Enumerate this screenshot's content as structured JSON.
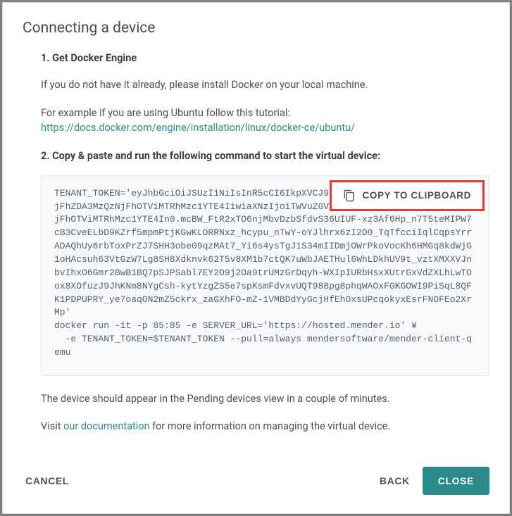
{
  "modal": {
    "title": "Connecting a device",
    "steps": {
      "step1_title": "1. Get Docker Engine",
      "step1_intro": "If you do not have it already, please install Docker on your local machine.",
      "step1_example_lead": "For example if you are using Ubuntu follow this tutorial:",
      "step1_link": "https://docs.docker.com/engine/installation/linux/docker-ce/ubuntu/",
      "step2_title": "2. Copy & paste and run the following command to start the virtual device:",
      "code": "TENANT_TOKEN='eyJhbGciOiJSUzI1NiIsInR5cCI6IkpXVCJ9.eyJtZW5kZXIudGVuYW50IjoiNjFhZDA3MzQzNjFhOTViMTRhMzc1YTE4IiwiaXNzIjoiTWVuZGVyIiwic3ViIjoiNjFhZDA3MzQzNjFhOTViMTRhMzc1YTE4In0.mcBW_FtR2xTO6njMbvDzbSfdvS36UIUF-xz3Af6Hp_n7T5teMIPW7cB3CveELbD9KZrf5mpmPtjKGwKLORRNxz_hcypu_nTwY-oYJlhrx6zI2D0_TqTfcciIqlCqpsYrrADAQhUy6rbToxPrZJ7SHH3obe09qzMAt7_Yi6s4ysTgJ1S34mIIDmjOWrPkoVocKh6HMGq8kdWjG1oHAcsuh63VtGzW7Lg8SH8Xdknvk62T5v8XM1b7ctQK7uWbJAETHul6WhLDkhUV9t_vztXMXXVJnbvIhxO6Gmr2BwB1BQ7pSJPSabl7EY2O9j2Oa9trUMzGrDqyh-WXIpIURbHsxXUtrGxVdZXLhLwTOox8XOfuzJ9JhKNm8NYgCsh-kytYzgZS5e7spKsmFdvxvUQT988pg8phqWAOxFGKGOWI9PiSqL8QFK1PDPUPRY_ye7oaqON2mZ5ckrx_zaGXhFO-mZ-1VMBDdYyGcjHfEhOxsUPcqokyxEsrFNOFEo2XrMp'\ndocker run -it -p 85:85 -e SERVER_URL='https://hosted.mender.io' ¥\n  -e TENANT_TOKEN=$TENANT_TOKEN --pull=always mendersoftware/mender-client-qemu",
      "copy_label": "COPY TO CLIPBOARD",
      "after_text": "The device should appear in the Pending devices view in a couple of minutes.",
      "visit_pre": "Visit ",
      "visit_link": "our documentation",
      "visit_post": " for more information on managing the virtual device."
    },
    "footer": {
      "cancel": "CANCEL",
      "back": "BACK",
      "close": "CLOSE"
    }
  }
}
